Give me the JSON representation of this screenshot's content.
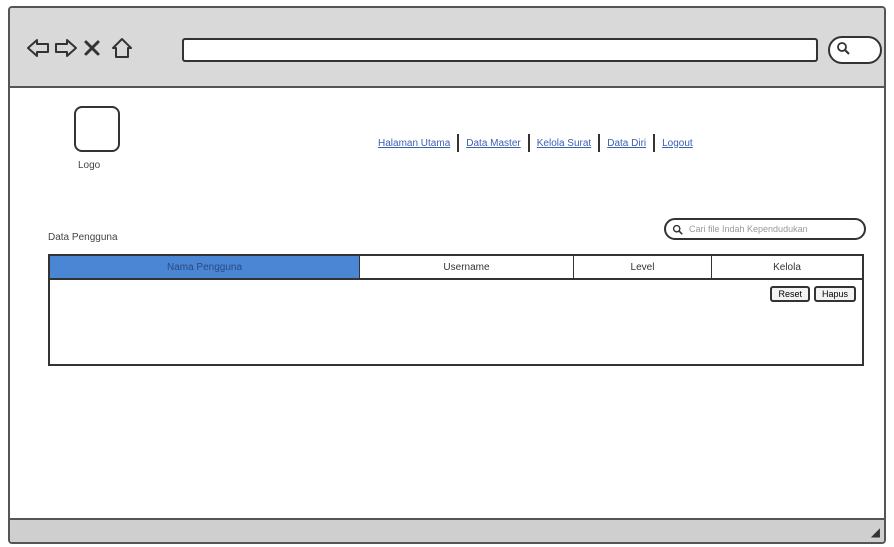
{
  "browser": {
    "back_icon": "arrow-left-icon",
    "forward_icon": "arrow-right-icon",
    "close_icon": "close-icon",
    "home_icon": "home-icon",
    "address_value": "",
    "search_icon": "search-icon"
  },
  "header": {
    "logo_label": "Logo",
    "nav": [
      "Halaman Utama",
      "Data Master",
      "Kelola Surat",
      "Data Diri",
      "Logout"
    ]
  },
  "main": {
    "section_title": "Data Pengguna",
    "search_placeholder": "Cari file Indah Kependudukan",
    "table": {
      "columns": [
        "Nama Pengguna",
        "Username",
        "Level",
        "Kelola"
      ],
      "active_column": 0,
      "actions": [
        "Reset",
        "Hapus"
      ]
    }
  },
  "colors": {
    "accent": "#4a86d4",
    "toolbar": "#d9d9d9",
    "link": "#3a5fb0"
  }
}
